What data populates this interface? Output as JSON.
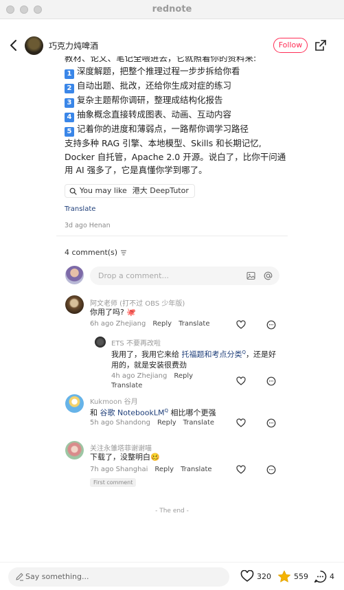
{
  "window": {
    "title": "rednote"
  },
  "header": {
    "author": "巧克力炖啤酒",
    "follow_label": "Follow"
  },
  "post": {
    "partial_line": "教材、论文、笔记全喂进去，它就照着你的资料来:",
    "list": [
      {
        "num": "1",
        "text": "深度解题，把整个推理过程一步步拆给你看"
      },
      {
        "num": "2",
        "text": "自动出题、批改，还给你生成对症的练习"
      },
      {
        "num": "3",
        "text": "复杂主题帮你调研，整理成结构化报告"
      },
      {
        "num": "4",
        "text": "抽象概念直接转成图表、动画、互动内容"
      },
      {
        "num": "5",
        "text": "记着你的进度和薄弱点，一路帮你调学习路径"
      }
    ],
    "para_lines": [
      "支持多种 RAG 引擎、本地模型、Skills 和长期记忆,",
      "Docker 自托管，Apache 2.0 开源。说白了，比你干问通",
      "用 AI 强多了，它是真懂你学到哪了。"
    ],
    "tag_prefix": "You may like",
    "tag_text": "港大 DeepTutor",
    "translate": "Translate",
    "meta": "3d ago Henan"
  },
  "comments_header": {
    "count_label": "4 comment(s)"
  },
  "comment_input": {
    "placeholder": "Drop a comment..."
  },
  "comments": [
    {
      "name": "阿文老师 (打不过 OBS 少年版)",
      "text": "你用了吗?",
      "emoji": "🐙",
      "time": "6h ago Zhejiang",
      "reply": "Reply",
      "translate": "Translate"
    },
    {
      "name": "ETS 不要再改啦",
      "text_line1_a": "我用了，我用它来给 ",
      "text_line1_link": "托福题和考点分类",
      "text_line1_b": "，还是好",
      "text_line2": "用的，就是安装很费劲",
      "time": "4h ago Zhejiang",
      "reply": "Reply",
      "translate": "Translate"
    },
    {
      "name": "Kukmoon 谷月",
      "text_a": "和 ",
      "text_link": "谷歌 NotebookLM",
      "text_b": " 相比哪个更强",
      "time": "5h ago Shandong",
      "reply": "Reply",
      "translate": "Translate"
    },
    {
      "name": "关注永雏塔菲谢谢喵",
      "text": "下载了，没整明白",
      "emoji": "🥴",
      "time": "7h ago Shanghai",
      "reply": "Reply",
      "translate": "Translate",
      "badge": "First comment"
    }
  ],
  "the_end": "- The end -",
  "bottom": {
    "say_placeholder": "Say something...",
    "likes": "320",
    "stars": "559",
    "comments": "4"
  },
  "colors": {
    "accent": "#ff2d55",
    "link": "#1f3f7a",
    "number_badge": "#3a86e8",
    "star": "#f5b301"
  }
}
